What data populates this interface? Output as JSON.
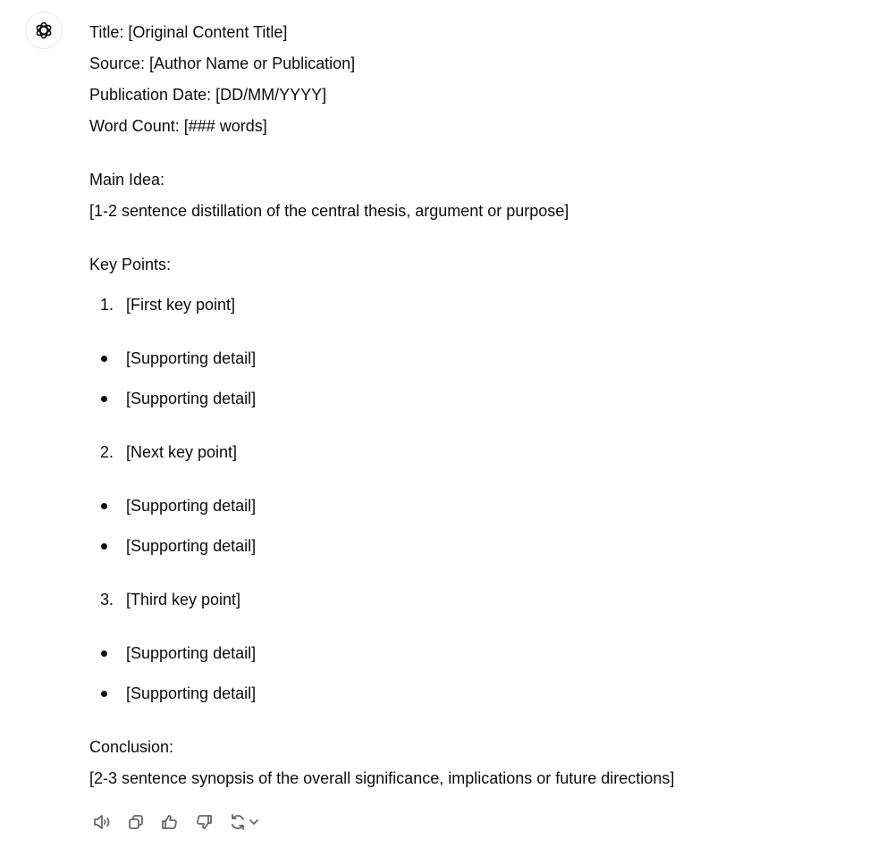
{
  "message": {
    "avatar_icon": "openai-logo-icon",
    "header_lines": [
      "Title: [Original Content Title]",
      "Source: [Author Name or Publication]",
      "Publication Date: [DD/MM/YYYY]",
      "Word Count: [### words]"
    ],
    "main_idea": {
      "label": "Main Idea:",
      "text": "[1-2 sentence distillation of the central thesis, argument or purpose]"
    },
    "key_points": {
      "label": "Key Points:",
      "items": [
        {
          "number": "1.",
          "text": "[First key point]",
          "details": [
            "[Supporting detail]",
            "[Supporting detail]"
          ]
        },
        {
          "number": "2.",
          "text": "[Next key point]",
          "details": [
            "[Supporting detail]",
            "[Supporting detail]"
          ]
        },
        {
          "number": "3.",
          "text": "[Third key point]",
          "details": [
            "[Supporting detail]",
            "[Supporting detail]"
          ]
        }
      ]
    },
    "conclusion": {
      "label": "Conclusion:",
      "text": "[2-3 sentence synopsis of the overall significance, implications or future directions]"
    }
  },
  "actions": [
    "read-aloud-icon",
    "copy-icon",
    "thumbs-up-icon",
    "thumbs-down-icon",
    "regenerate-icon",
    "chevron-down-icon"
  ]
}
